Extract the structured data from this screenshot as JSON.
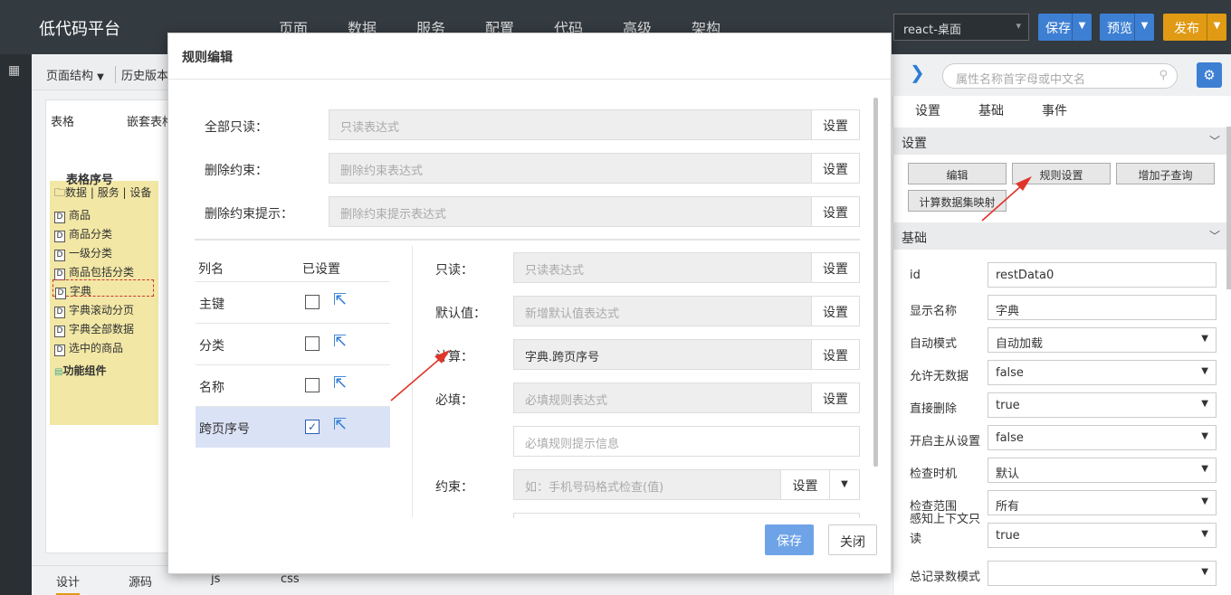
{
  "app": {
    "title": "低代码平台",
    "nav": [
      "页面",
      "数据",
      "服务",
      "配置",
      "代码",
      "高级",
      "架构"
    ],
    "project": "react-桌面",
    "save": "保存",
    "preview": "预览",
    "publish": "发布"
  },
  "left": {
    "page_structure": "页面结构",
    "history": "历史版本",
    "tabs": [
      "表格",
      "嵌套表格"
    ],
    "tree_header": "表格序号",
    "tree_root": "数据 | 服务 | 设备",
    "tree_items": [
      "商品",
      "商品分类",
      "一级分类",
      "商品包括分类",
      "字典",
      "字典滚动分页",
      "字典全部数据",
      "选中的商品"
    ],
    "tree_func": "功能组件"
  },
  "bottom_tabs": [
    "设计",
    "源码",
    "js",
    "css"
  ],
  "right": {
    "search_placeholder": "属性名称首字母或中文名",
    "tabs": [
      "设置",
      "基础",
      "事件"
    ],
    "section_settings": "设置",
    "buttons": [
      "编辑",
      "规则设置",
      "增加子查询",
      "计算数据集映射"
    ],
    "section_basic": "基础",
    "props": [
      {
        "label": "id",
        "value": "restData0",
        "select": false
      },
      {
        "label": "显示名称",
        "value": "字典",
        "select": false
      },
      {
        "label": "自动模式",
        "value": "自动加载",
        "select": true
      },
      {
        "label": "允许无数据",
        "value": "false",
        "select": true
      },
      {
        "label": "直接删除",
        "value": "true",
        "select": true
      },
      {
        "label": "开启主从设置",
        "value": "false",
        "select": true
      },
      {
        "label": "检查时机",
        "value": "默认",
        "select": true
      },
      {
        "label": "检查范围",
        "value": "所有",
        "select": true
      },
      {
        "label": "感知上下文只读",
        "value": "true",
        "select": true
      },
      {
        "label": "总记录数模式",
        "value": "",
        "select": true
      }
    ]
  },
  "modal": {
    "title": "规则编辑",
    "set": "设置",
    "global": [
      {
        "label": "全部只读：",
        "placeholder": "只读表达式"
      },
      {
        "label": "删除约束：",
        "placeholder": "删除约束表达式"
      },
      {
        "label": "删除约束提示：",
        "placeholder": "删除约束提示表达式"
      }
    ],
    "col_header_name": "列名",
    "col_header_set": "已设置",
    "columns": [
      {
        "name": "主键",
        "checked": false
      },
      {
        "name": "分类",
        "checked": false
      },
      {
        "name": "名称",
        "checked": false
      },
      {
        "name": "跨页序号",
        "checked": true
      }
    ],
    "rules": {
      "readonly_label": "只读：",
      "readonly_ph": "只读表达式",
      "default_label": "默认值：",
      "default_ph": "新增默认值表达式",
      "calc_label": "计算：",
      "calc_value": "字典.跨页序号",
      "required_label": "必填：",
      "required_ph": "必填规则表达式",
      "required_msg_ph": "必填规则提示信息",
      "constraint_label": "约束：",
      "constraint_ph": "如：手机号码格式检查(值)"
    },
    "save": "保存",
    "close": "关闭"
  }
}
